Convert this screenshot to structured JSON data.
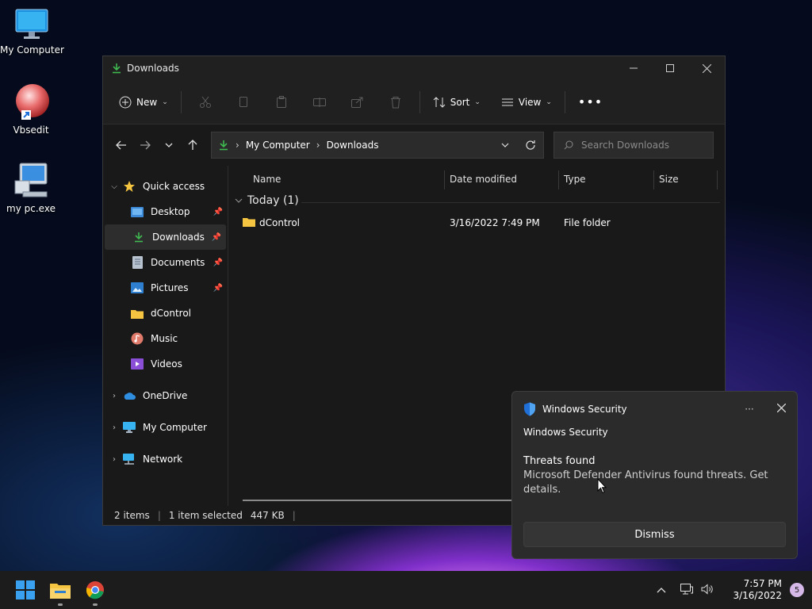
{
  "desktop": {
    "icons": [
      {
        "label": "My Computer",
        "icon": "monitor-icon"
      },
      {
        "label": "Vbsedit",
        "icon": "vbsedit-ball-icon"
      },
      {
        "label": "my pc.exe",
        "icon": "pc-exe-icon"
      }
    ]
  },
  "explorer": {
    "title": "Downloads",
    "toolbar": {
      "new_label": "New",
      "sort_label": "Sort",
      "view_label": "View"
    },
    "address": {
      "crumbs": [
        "My Computer",
        "Downloads"
      ]
    },
    "search": {
      "placeholder": "Search Downloads"
    },
    "sidebar": {
      "quick_access": "Quick access",
      "items": [
        {
          "label": "Desktop",
          "pinned": true
        },
        {
          "label": "Downloads",
          "pinned": true
        },
        {
          "label": "Documents",
          "pinned": true
        },
        {
          "label": "Pictures",
          "pinned": true
        },
        {
          "label": "dControl",
          "pinned": false
        },
        {
          "label": "Music",
          "pinned": false
        },
        {
          "label": "Videos",
          "pinned": false
        }
      ],
      "roots": [
        "OneDrive",
        "My Computer",
        "Network"
      ]
    },
    "columns": [
      "Name",
      "Date modified",
      "Type",
      "Size"
    ],
    "group": "Today (1)",
    "files": [
      {
        "name": "dControl",
        "date": "3/16/2022 7:49 PM",
        "type": "File folder",
        "size": ""
      }
    ],
    "status": {
      "items": "2 items",
      "selected": "1 item selected",
      "size": "447 KB"
    }
  },
  "toast": {
    "app": "Windows Security",
    "source": "Windows Security",
    "heading": "Threats found",
    "message": "Microsoft Defender Antivirus found threats. Get details.",
    "dismiss_label": "Dismiss"
  },
  "taskbar": {
    "time": "7:57 PM",
    "date": "3/16/2022",
    "notification_count": "5"
  },
  "colors": {
    "accent": "#0078d4",
    "folder": "#f5c542",
    "download": "#3fb950"
  }
}
